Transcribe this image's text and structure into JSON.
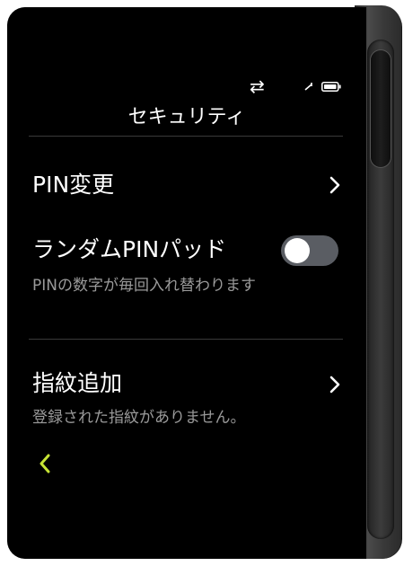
{
  "header": {
    "title": "セキュリティ"
  },
  "status": {
    "sync_icon": "⇄",
    "icons": [
      "sync-icon",
      "signal-icon",
      "battery-icon"
    ]
  },
  "settings": {
    "pin_change": {
      "label": "PIN変更"
    },
    "random_pin_pad": {
      "label": "ランダムPINパッド",
      "description": "PINの数字が毎回入れ替わります",
      "enabled": false
    },
    "fingerprint": {
      "label": "指紋追加",
      "description": "登録された指紋がありません。"
    }
  },
  "navigation": {
    "back_icon": "chevron-left-icon"
  },
  "colors": {
    "background": "#000000",
    "text_primary": "#ffffff",
    "text_secondary": "#9a9a9a",
    "accent": "#c6e335",
    "toggle_off_track": "#5a5d63"
  }
}
